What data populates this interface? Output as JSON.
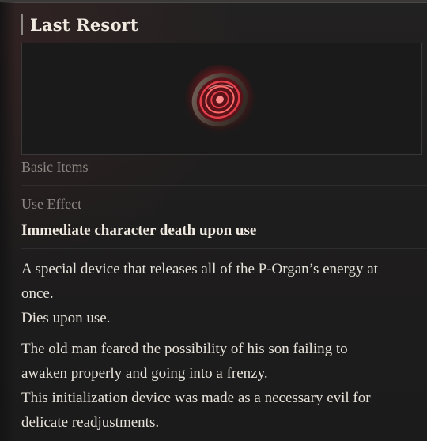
{
  "item": {
    "title": "Last Resort",
    "image_icon": "red-disc-device-icon",
    "category": "Basic Items",
    "use_effect_label": "Use Effect",
    "use_effect_text": "Immediate character death upon use"
  },
  "description": {
    "paragraph1": [
      "A special device that releases all of the P-Organ’s energy at",
      "once.",
      "Dies upon use."
    ],
    "paragraph2": [
      "The old man feared the possibility of his son failing to",
      "awaken properly and going into a frenzy.",
      "This initialization device was made as a necessary evil for",
      "delicate readjustments."
    ]
  },
  "colors": {
    "background": "#1e1d1d",
    "title_text": "#efe9df",
    "muted_text": "#8b8682",
    "body_text": "#e6e1d8",
    "accent_red": "#c0303a"
  }
}
